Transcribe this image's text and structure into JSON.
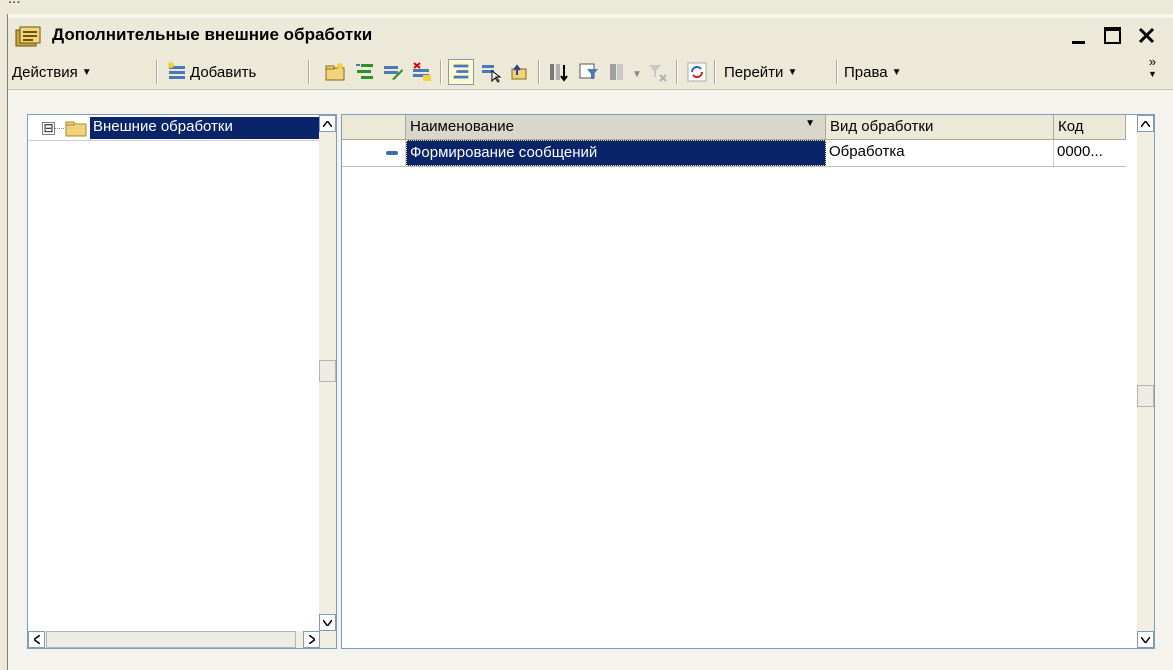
{
  "background_caption": "...",
  "window": {
    "title": "Дополнительные внешние обработки",
    "minimize": "_",
    "maximize": "☐",
    "close": "✕"
  },
  "toolbar": {
    "actions_label": "Действия",
    "add_label": "Добавить",
    "goto_label": "Перейти",
    "rights_label": "Права",
    "more_label": "»"
  },
  "tree": {
    "root_label": "Внешние обработки",
    "expander": "⊟"
  },
  "list": {
    "columns": {
      "name": "Наименование",
      "kind": "Вид обработки",
      "code": "Код"
    },
    "rows": [
      {
        "name": "Формирование сообщений",
        "kind": "Обработка",
        "code": "0000..."
      }
    ]
  },
  "colors": {
    "selection": "#0a246a",
    "window_bg": "#ece9d8",
    "pane_border": "#7f9db9"
  }
}
